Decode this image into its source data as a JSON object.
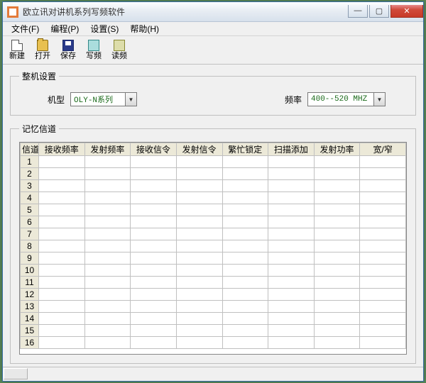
{
  "window": {
    "title": "欧立讯对讲机系列写频软件"
  },
  "menu": {
    "file": "文件(F)",
    "program": "编程(P)",
    "settings": "设置(S)",
    "help": "帮助(H)"
  },
  "toolbar": {
    "new": "新建",
    "open": "打开",
    "save": "保存",
    "write": "写频",
    "read": "读频"
  },
  "section_settings": {
    "legend": "整机设置",
    "model_label": "机型",
    "model_value": "OLY-N系列",
    "freq_label": "频率",
    "freq_value": "400--520 MHZ"
  },
  "section_channels": {
    "legend": "记忆信道",
    "columns": [
      "信道",
      "接收频率",
      "发射频率",
      "接收信令",
      "发射信令",
      "繁忙锁定",
      "扫描添加",
      "发射功率",
      "宽/窄"
    ],
    "rows": [
      "1",
      "2",
      "3",
      "4",
      "5",
      "6",
      "7",
      "8",
      "9",
      "10",
      "11",
      "12",
      "13",
      "14",
      "15",
      "16"
    ],
    "selected_row": 0,
    "selected_col": 1
  }
}
